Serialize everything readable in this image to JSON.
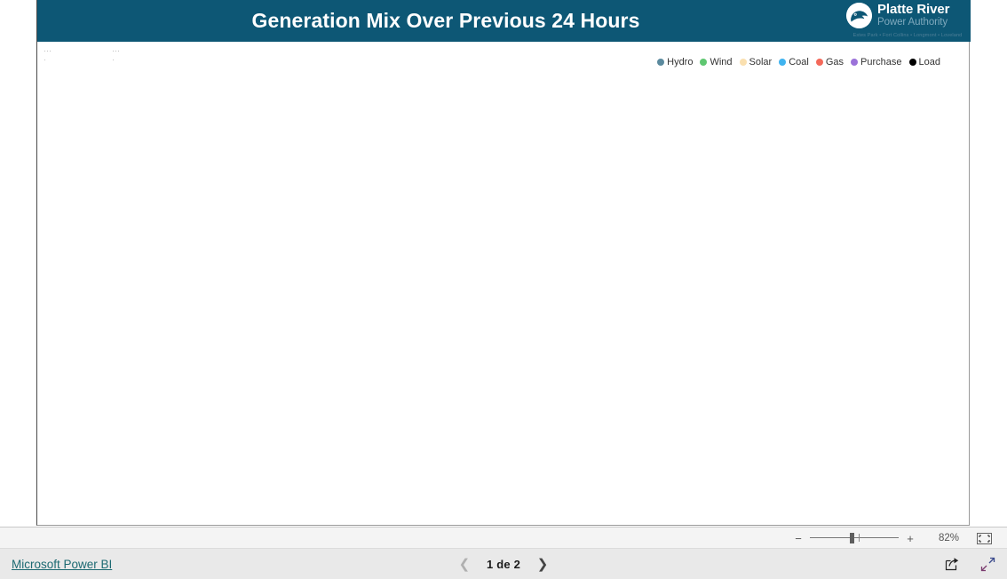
{
  "report": {
    "title": "Generation Mix Over Previous 24 Hours",
    "header_color": "#0d5775"
  },
  "logo": {
    "mark_icon": "platte-river-circle-logo",
    "name": "Platte River",
    "subtitle": "Power Authority",
    "tagline": "Estes Park • Fort Collins • Longmont • Loveland"
  },
  "chart_data": {
    "type": "area",
    "title": "Generation Mix Over Previous 24 Hours",
    "xlabel": "",
    "ylabel": "",
    "legend_position": "top-right",
    "grid": false,
    "state": "loading",
    "categories": [],
    "series": [
      {
        "name": "Hydro",
        "color": "#5b8a9e",
        "values": []
      },
      {
        "name": "Wind",
        "color": "#5fc771",
        "values": []
      },
      {
        "name": "Solar",
        "color": "#fae0b0",
        "values": []
      },
      {
        "name": "Coal",
        "color": "#3fb3ef",
        "values": []
      },
      {
        "name": "Gas",
        "color": "#f4695a",
        "values": []
      },
      {
        "name": "Purchase",
        "color": "#9b72d9",
        "values": []
      },
      {
        "name": "Load",
        "color": "#000000",
        "values": []
      }
    ]
  },
  "legend": {
    "items": [
      {
        "label": "Hydro",
        "color": "#5b8a9e"
      },
      {
        "label": "Wind",
        "color": "#5fc771"
      },
      {
        "label": "Solar",
        "color": "#fae0b0"
      },
      {
        "label": "Coal",
        "color": "#3fb3ef"
      },
      {
        "label": "Gas",
        "color": "#f4695a"
      },
      {
        "label": "Purchase",
        "color": "#9b72d9"
      },
      {
        "label": "Load",
        "color": "#000000"
      }
    ]
  },
  "status_bar": {
    "zoom_out_label": "−",
    "zoom_in_label": "+",
    "zoom_percent": "82%",
    "fit_icon": "fit-to-page-icon"
  },
  "footer": {
    "brand_link": "Microsoft Power BI",
    "prev_icon": "chevron-left-icon",
    "next_icon": "chevron-right-icon",
    "page_label": "1 de 2",
    "share_icon": "share-icon",
    "fullscreen_icon": "fullscreen-icon"
  }
}
